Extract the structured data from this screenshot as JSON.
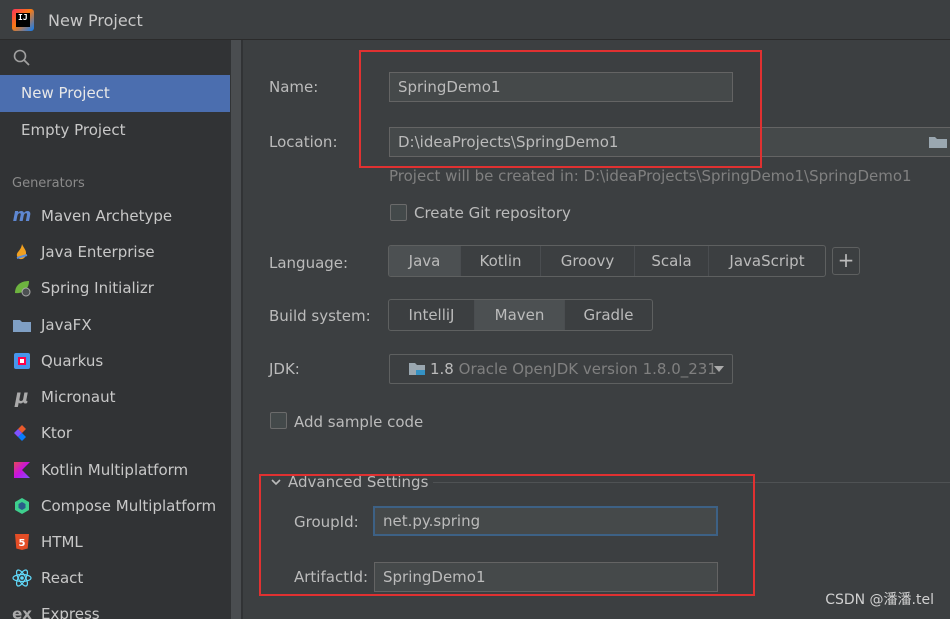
{
  "window": {
    "title": "New Project"
  },
  "sidebar": {
    "items": [
      {
        "label": "New Project"
      },
      {
        "label": "Empty Project"
      }
    ],
    "generators_label": "Generators",
    "generators": [
      {
        "label": "Maven Archetype",
        "icon": "m",
        "color": "#5e87d1"
      },
      {
        "label": "Java Enterprise",
        "icon": "flame",
        "color": "#f0a020"
      },
      {
        "label": "Spring Initializr",
        "icon": "spring",
        "color": "#6db33f"
      },
      {
        "label": "JavaFX",
        "icon": "folder",
        "color": "#7f9fc4"
      },
      {
        "label": "Quarkus",
        "icon": "quarkus",
        "color": "#4695eb"
      },
      {
        "label": "Micronaut",
        "icon": "μ",
        "color": "#aaaaaa"
      },
      {
        "label": "Ktor",
        "icon": "ktor",
        "color": "#e85a2c"
      },
      {
        "label": "Kotlin Multiplatform",
        "icon": "kotlin",
        "color": "#a97bff"
      },
      {
        "label": "Compose Multiplatform",
        "icon": "compose",
        "color": "#3ecf8e"
      },
      {
        "label": "HTML",
        "icon": "5",
        "color": "#e44d26"
      },
      {
        "label": "React",
        "icon": "⚛",
        "color": "#61dafb"
      },
      {
        "label": "Express",
        "icon": "ex",
        "color": "#aaaaaa"
      }
    ]
  },
  "form": {
    "name_label": "Name:",
    "name_value": "SpringDemo1",
    "location_label": "Location:",
    "location_value": "D:\\ideaProjects\\SpringDemo1",
    "location_hint": "Project will be created in: D:\\ideaProjects\\SpringDemo1\\SpringDemo1",
    "git_label": "Create Git repository",
    "language_label": "Language:",
    "languages": [
      "Java",
      "Kotlin",
      "Groovy",
      "Scala",
      "JavaScript"
    ],
    "language_selected": "Java",
    "add_button": "+",
    "build_label": "Build system:",
    "build_systems": [
      "IntelliJ",
      "Maven",
      "Gradle"
    ],
    "build_selected": "Maven",
    "jdk_label": "JDK:",
    "jdk_version": "1.8",
    "jdk_detail": "Oracle OpenJDK version 1.8.0_231",
    "sample_label": "Add sample code",
    "advanced_label": "Advanced Settings",
    "groupid_label": "GroupId:",
    "groupid_value": "net.py.spring",
    "artifactid_label": "ArtifactId:",
    "artifactid_value": "SpringDemo1"
  },
  "watermark": "CSDN @潘潘.tel",
  "colors": {
    "accent": "#4b6eaf",
    "highlight_box": "#e03131",
    "background": "#3c3f41",
    "sidebar": "#313335"
  }
}
